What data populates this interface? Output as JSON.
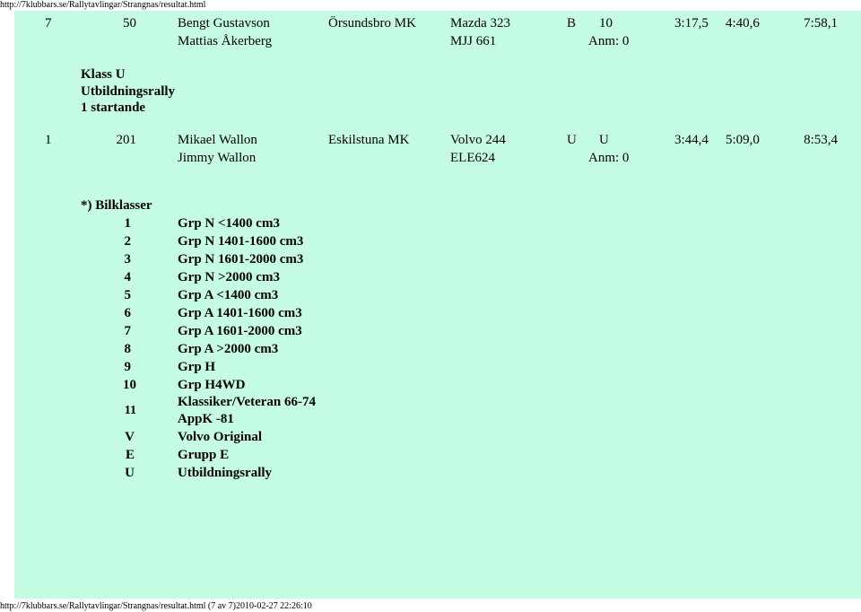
{
  "header_url": "http://7klubbars.se/Rallytavlingar/Strangnas/resultat.html",
  "footer": "http://7klubbars.se/Rallytavlingar/Strangnas/resultat.html (7 av 7)2010-02-27 22:26:10",
  "entries": [
    {
      "place": "7",
      "number": "50",
      "driver": "Bengt Gustavson",
      "codriver": "Mattias Åkerberg",
      "club": "Örsundsbro MK",
      "car": "Mazda 323",
      "reg": "MJJ 661",
      "class": "B",
      "group": "10",
      "anm": "Anm: 0",
      "t1": "3:17,5",
      "t2": "4:40,6",
      "total": "7:58,1"
    },
    {
      "place": "1",
      "number": "201",
      "driver": "Mikael Wallon",
      "codriver": "Jimmy Wallon",
      "club": "Eskilstuna MK",
      "car": "Volvo 244",
      "reg": "ELE624",
      "class": "U",
      "group": "U",
      "anm": "Anm: 0",
      "t1": "3:44,4",
      "t2": "5:09,0",
      "total": "8:53,4"
    }
  ],
  "class_header": {
    "klass": "Klass U",
    "name": "Utbildningsrally",
    "starters": "1 startande"
  },
  "bilklasser": {
    "title": "*) Bilklasser",
    "items": [
      {
        "code": "1",
        "label": "Grp N <1400 cm3"
      },
      {
        "code": "2",
        "label": "Grp N 1401-1600 cm3"
      },
      {
        "code": "3",
        "label": "Grp N 1601-2000 cm3"
      },
      {
        "code": "4",
        "label": "Grp N >2000 cm3"
      },
      {
        "code": "5",
        "label": "Grp A <1400 cm3"
      },
      {
        "code": "6",
        "label": "Grp A 1401-1600 cm3"
      },
      {
        "code": "7",
        "label": "Grp A 1601-2000 cm3"
      },
      {
        "code": "8",
        "label": "Grp A >2000 cm3"
      },
      {
        "code": "9",
        "label": "Grp H"
      },
      {
        "code": "10",
        "label": "Grp H4WD"
      },
      {
        "code": "11",
        "label": "Klassiker/Veteran 66-74",
        "label2": "AppK -81"
      },
      {
        "code": "V",
        "label": "Volvo Original"
      },
      {
        "code": "E",
        "label": "Grupp E"
      },
      {
        "code": "U",
        "label": "Utbildningsrally"
      }
    ]
  }
}
